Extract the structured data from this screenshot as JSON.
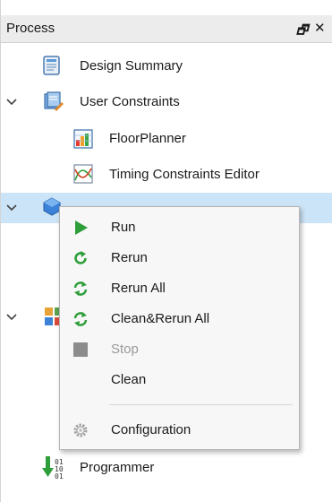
{
  "panel": {
    "title": "Process",
    "restore_icon": "restore-window-icon",
    "close_icon": "close-icon",
    "restore_glyph": "🗗",
    "close_glyph": "✕"
  },
  "tree": {
    "design_summary": "Design Summary",
    "user_constraints": "User Constraints",
    "floorplanner": "FloorPlanner",
    "timing_editor": "Timing Constraints Editor",
    "programmer": "Programmer"
  },
  "menu": {
    "items": [
      {
        "label": "Run",
        "icon": "play-icon",
        "enabled": true
      },
      {
        "label": "Rerun",
        "icon": "rerun-icon",
        "enabled": true
      },
      {
        "label": "Rerun All",
        "icon": "rerun-all-icon",
        "enabled": true
      },
      {
        "label": "Clean&Rerun All",
        "icon": "clean-rerun-all-icon",
        "enabled": true
      },
      {
        "label": "Stop",
        "icon": "stop-icon",
        "enabled": false
      },
      {
        "label": "Clean",
        "icon": "",
        "enabled": true
      },
      {
        "label": "Configuration",
        "icon": "gear-icon",
        "enabled": true
      }
    ]
  },
  "colors": {
    "selection": "#cce4f7",
    "run_green": "#2e9e3a",
    "stop_gray": "#8c8c8c"
  }
}
